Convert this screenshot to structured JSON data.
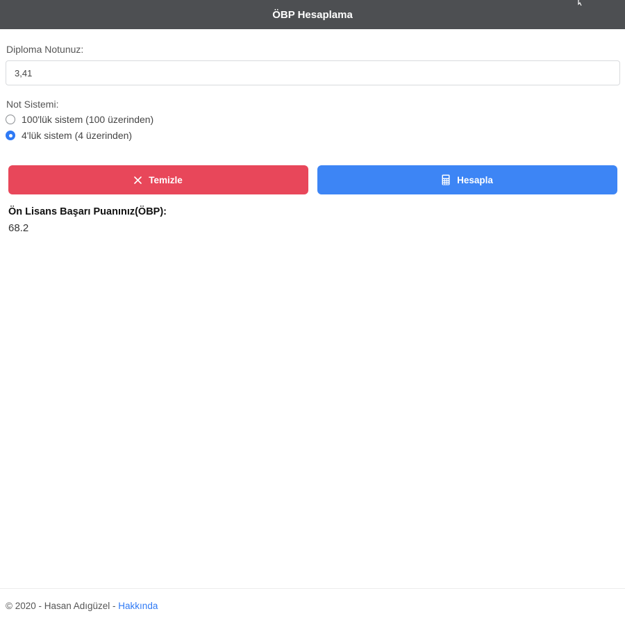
{
  "header": {
    "title": "ÖBP Hesaplama"
  },
  "form": {
    "diploma_label": "Diploma Notunuz:",
    "diploma_value": "3,41",
    "system_label": "Not Sistemi:",
    "options": [
      {
        "label": "100'lük sistem (100 üzerinden)",
        "checked": false
      },
      {
        "label": "4'lük sistem (4 üzerinden)",
        "checked": true
      }
    ]
  },
  "buttons": {
    "clear_label": "Temizle",
    "calculate_label": "Hesapla",
    "clear_color": "#e8475a",
    "calculate_color": "#3d85f5"
  },
  "result": {
    "label": "Ön Lisans Başarı Puanınız(ÖBP):",
    "value": "68.2"
  },
  "footer": {
    "copyright": "© 2020 - Hasan Adıgüzel - ",
    "link_label": "Hakkında"
  },
  "icons": {
    "clear": "close-icon",
    "calculate": "calculator-icon",
    "corner": "cursor-icon"
  },
  "colors": {
    "header_bg": "#4d4f52",
    "accent": "#2f7af5"
  }
}
